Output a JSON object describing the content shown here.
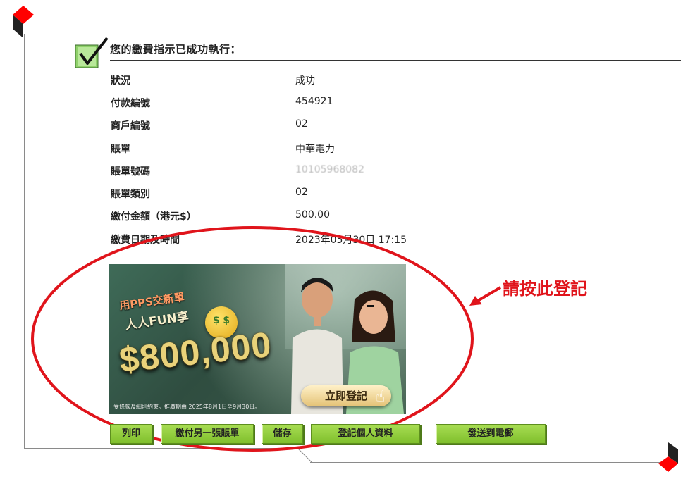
{
  "header": {
    "title": "您的繳費指示已成功執行："
  },
  "details": [
    {
      "label": "狀況",
      "value": "成功"
    },
    {
      "label": "付款編號",
      "value": "454921"
    },
    {
      "label": "商戶編號",
      "value": "02"
    },
    {
      "label": "賬單",
      "value": "中華電力"
    },
    {
      "label": "賬單號碼",
      "value": "10105968082"
    },
    {
      "label": "賬單類別",
      "value": "02"
    },
    {
      "label": "繳付金額（港元$）",
      "value": "500.00"
    },
    {
      "label": "繳費日期及時間",
      "value": "2023年05月30日 17:15"
    }
  ],
  "banner": {
    "slogan_line1": "用PPS交新單",
    "slogan_line2": "人人FUN享",
    "amount": "$800,000",
    "emoji_text": "$ $",
    "cta": "立即登記",
    "terms": "受條款及細則約束。推廣期由 2025年8月1日至9月30日。"
  },
  "annotation": {
    "text": "請按此登記",
    "color": "#e0141b"
  },
  "buttons": {
    "print": "列印",
    "pay_another": "繳付另一張賬單",
    "save": "儲存",
    "register_profile": "登記個人資料",
    "send_email": "發送到電郵"
  },
  "colors": {
    "button_green": "#8fcb3a",
    "highlight_red": "#e0141b",
    "corner_red": "#ff0000"
  }
}
